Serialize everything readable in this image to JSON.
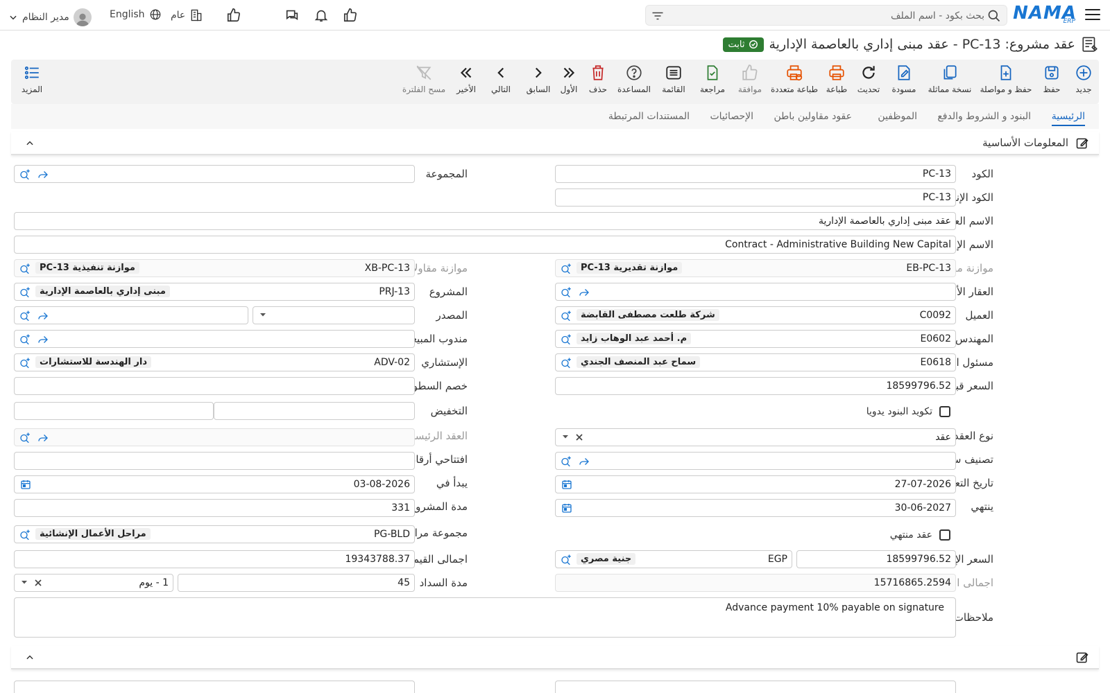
{
  "topbar": {
    "logo": "NAMA",
    "logo_sub": "ERP",
    "search_placeholder": "بحث بكود - اسم الملف",
    "user": "مدير النظام",
    "language": "English",
    "branch": "عام"
  },
  "header": {
    "title": "عقد مشروع: PC-13 - عقد مبنى إداري بالعاصمة الإدارية",
    "status": "ثابت"
  },
  "toolbar": {
    "new": "جديد",
    "save": "حفظ",
    "save_continue": "حفظ و مواصلة",
    "duplicate": "نسخة مماثلة",
    "draft": "مسودة",
    "refresh": "تحديث",
    "print": "طباعة",
    "multi_print": "طباعة متعددة",
    "approve": "موافقة",
    "review": "مراجعة",
    "list": "القائمة",
    "help": "المساعدة",
    "delete": "حذف",
    "first": "الأول",
    "previous": "السابق",
    "next": "التالي",
    "last": "الأخير",
    "clear_filter": "مسح الفلترة",
    "more": "المزيد"
  },
  "tabs": [
    "الرئيسية",
    "البنود و الشروط والدفع",
    "الموظفين",
    "عقود مقاولين باطن",
    "الإحصائيات",
    "المستندات المرتبطة"
  ],
  "section": {
    "title": "المعلومات الأساسية"
  },
  "form": {
    "code": {
      "label": "الكود",
      "value": "PC-13"
    },
    "group": {
      "label": "المجموعة",
      "value": ""
    },
    "en_code": {
      "label": "الكود الإنجليزي",
      "value": "PC-13"
    },
    "ar_name": {
      "label": "الاسم العربي",
      "value": "عقد مبنى إداري بالعاصمة الإدارية"
    },
    "en_name": {
      "label": "الاسم الإنجليزي",
      "value": "Contract - Administrative Building New Capital"
    },
    "est_budget": {
      "label": "موازنة مقاولات تقديرية",
      "code": "EB-PC-13",
      "name": "موازنة تقديرية PC-13"
    },
    "exec_budget": {
      "label": "موازنة مقاولات تنفيذية",
      "code": "XB-PC-13",
      "name": "موازنة تنفيذية PC-13"
    },
    "parent_property": {
      "label": "العقار الأعلى",
      "value": ""
    },
    "project": {
      "label": "المشروع",
      "code": "PRJ-13",
      "name": "مبنى إداري بالعاصمة الإدارية"
    },
    "customer": {
      "label": "العميل",
      "code": "C0092",
      "name": "شركة طلعت مصطفى القابضة"
    },
    "source": {
      "label": "المصدر",
      "value": ""
    },
    "engineer": {
      "label": "المهندس المسئول",
      "code": "E0602",
      "name": "م. أحمد عبد الوهاب زايد"
    },
    "sales_rep": {
      "label": "مندوب المبيعات",
      "value": ""
    },
    "sales_manager": {
      "label": "مسئول المبيعات",
      "code": "E0618",
      "name": "سماح عبد المنصف الجندي"
    },
    "consultant": {
      "label": "الإستشاري",
      "code": "ADV-02",
      "name": "دار الهندسة للاستشارات"
    },
    "price_before_discount": {
      "label": "السعر قبل التخفيض",
      "value": "18599796.52"
    },
    "unified_line_discount": {
      "label": "خصم السطور الموحد",
      "value": ""
    },
    "manual_items": {
      "label": "تكويد البنود يدويا"
    },
    "discount": {
      "label": "التخفيض",
      "value1": "",
      "value2": ""
    },
    "contract_type": {
      "label": "نوع العقد",
      "value": "عقد"
    },
    "main_contract": {
      "label": "العقد الرئيسي",
      "value": ""
    },
    "record_class": {
      "label": "تصنيف سجل",
      "value": ""
    },
    "extract_prefix": {
      "label": "افتتاحي أرقام المستخلصات",
      "value": ""
    },
    "contract_date": {
      "label": "تاريخ التعاقد",
      "value": "27-07-2026"
    },
    "starts_at": {
      "label": "يبدأ في",
      "value": "03-08-2026"
    },
    "ends": {
      "label": "ينتهي",
      "value": "30-06-2027"
    },
    "duration_days": {
      "label": "مدة المشروع بالأيام",
      "value": "331"
    },
    "ended_contract": {
      "label": "عقد منتهي"
    },
    "stages_group": {
      "label": "مجموعة مراحل",
      "code": "PG-BLD",
      "name": "مراحل الأعمال الإنشائية"
    },
    "base_price": {
      "label": "السعر الإساسي",
      "value": "18599796.52",
      "currency_code": "EGP",
      "currency_name": "جنية مصري"
    },
    "total_due": {
      "label": "اجمالى القيمة المستحقة",
      "value": "19343788.37"
    },
    "total_cost": {
      "label": "اجمالى التكلفة",
      "value": "15716865.2594"
    },
    "payment_period": {
      "label": "مدة السداد",
      "value": "45",
      "unit": "1 - يوم"
    },
    "notes": {
      "label": "ملاحظات",
      "value": "Advance payment 10% payable on signature"
    }
  },
  "colors": {
    "brand": "#1976d2",
    "status_green": "#2e7d32",
    "delete_red": "#c62828",
    "accent_blue": "#1565c0"
  }
}
